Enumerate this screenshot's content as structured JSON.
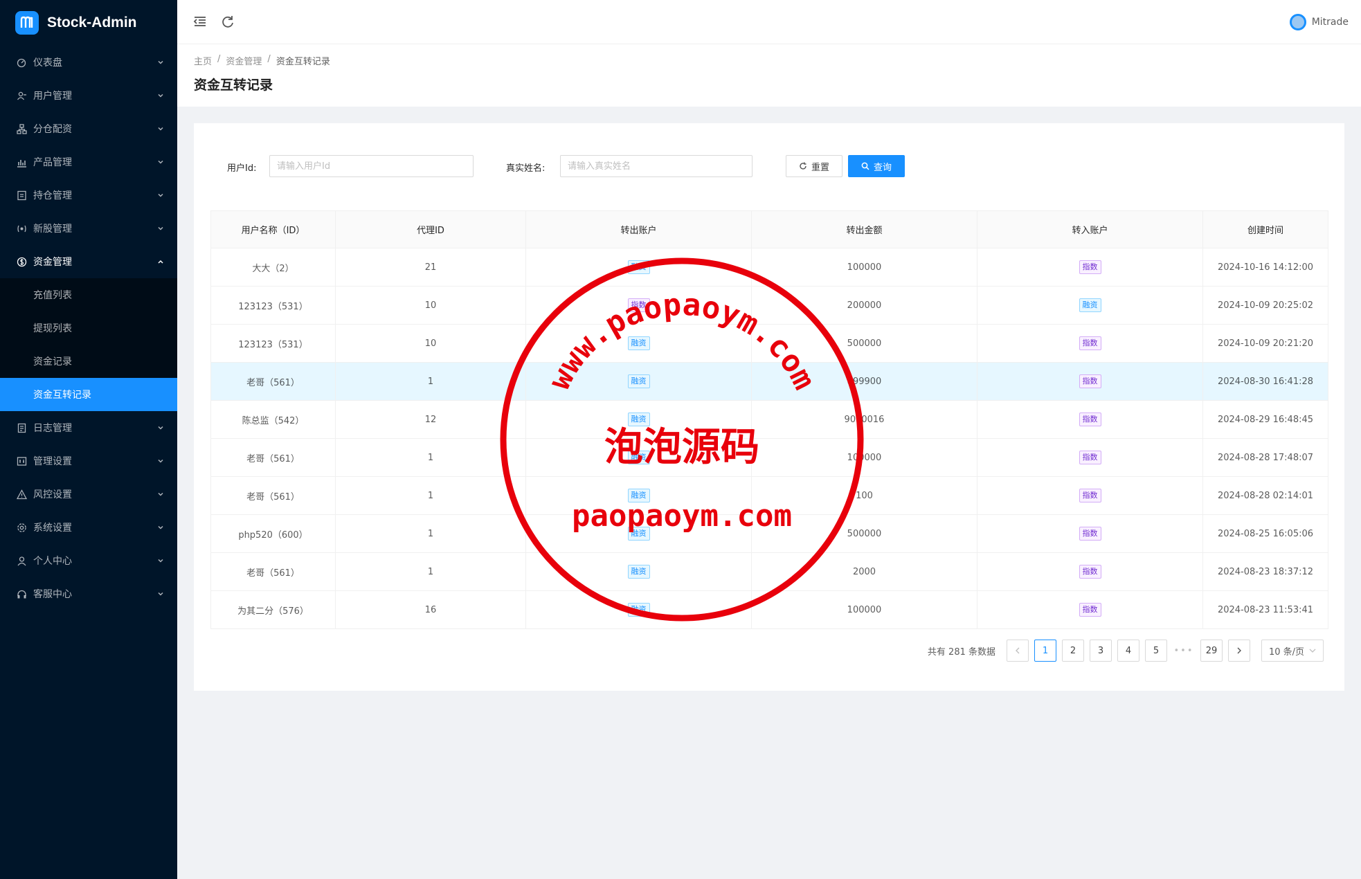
{
  "app": {
    "title": "Stock-Admin"
  },
  "header": {
    "username": "Mitrade"
  },
  "sidebar": {
    "items": [
      {
        "label": "仪表盘",
        "icon": "dashboard-icon"
      },
      {
        "label": "用户管理",
        "icon": "users-icon"
      },
      {
        "label": "分仓配资",
        "icon": "cluster-icon"
      },
      {
        "label": "产品管理",
        "icon": "bar-chart-icon"
      },
      {
        "label": "持仓管理",
        "icon": "holding-icon"
      },
      {
        "label": "新股管理",
        "icon": "new-stock-icon"
      },
      {
        "label": "资金管理",
        "icon": "dollar-circle-icon",
        "open": true
      },
      {
        "label": "日志管理",
        "icon": "log-icon"
      },
      {
        "label": "管理设置",
        "icon": "admin-settings-icon"
      },
      {
        "label": "风控设置",
        "icon": "warning-icon"
      },
      {
        "label": "系统设置",
        "icon": "gear-icon"
      },
      {
        "label": "个人中心",
        "icon": "user-icon"
      },
      {
        "label": "客服中心",
        "icon": "headset-icon"
      }
    ],
    "fund_submenu": [
      {
        "label": "充值列表"
      },
      {
        "label": "提现列表"
      },
      {
        "label": "资金记录"
      },
      {
        "label": "资金互转记录",
        "active": true
      }
    ]
  },
  "breadcrumb": {
    "home": "主页",
    "parent": "资金管理",
    "current": "资金互转记录"
  },
  "page_title": "资金互转记录",
  "filters": {
    "user_id_label": "用户Id:",
    "user_id_placeholder": "请输入用户Id",
    "real_name_label": "真实姓名:",
    "real_name_placeholder": "请输入真实姓名",
    "reset_label": "重置",
    "query_label": "查询"
  },
  "table": {
    "columns": [
      "用户名称（ID）",
      "代理ID",
      "转出账户",
      "转出金额",
      "转入账户",
      "创建时间"
    ],
    "rows": [
      {
        "user": "大大（2）",
        "agent": "21",
        "from": "融资",
        "amount": "100000",
        "to": "指数",
        "time": "2024-10-16 14:12:00"
      },
      {
        "user": "123123（531）",
        "agent": "10",
        "from": "指数",
        "amount": "200000",
        "to": "融资",
        "time": "2024-10-09 20:25:02"
      },
      {
        "user": "123123（531）",
        "agent": "10",
        "from": "融资",
        "amount": "500000",
        "to": "指数",
        "time": "2024-10-09 20:21:20"
      },
      {
        "user": "老哥（561）",
        "agent": "1",
        "from": "融资",
        "amount": "899900",
        "to": "指数",
        "time": "2024-08-30 16:41:28"
      },
      {
        "user": "陈总监（542）",
        "agent": "12",
        "from": "融资",
        "amount": "9000016",
        "to": "指数",
        "time": "2024-08-29 16:48:45"
      },
      {
        "user": "老哥（561）",
        "agent": "1",
        "from": "融资",
        "amount": "100000",
        "to": "指数",
        "time": "2024-08-28 17:48:07"
      },
      {
        "user": "老哥（561）",
        "agent": "1",
        "from": "融资",
        "amount": "100",
        "to": "指数",
        "time": "2024-08-28 02:14:01"
      },
      {
        "user": "php520（600）",
        "agent": "1",
        "from": "融资",
        "amount": "500000",
        "to": "指数",
        "time": "2024-08-25 16:05:06"
      },
      {
        "user": "老哥（561）",
        "agent": "1",
        "from": "融资",
        "amount": "2000",
        "to": "指数",
        "time": "2024-08-23 18:37:12"
      },
      {
        "user": "为其二分（576）",
        "agent": "16",
        "from": "融资",
        "amount": "100000",
        "to": "指数",
        "time": "2024-08-23 11:53:41"
      }
    ],
    "highlight_row": 3
  },
  "pagination": {
    "total_text": "共有 281 条数据",
    "pages": [
      "1",
      "2",
      "3",
      "4",
      "5"
    ],
    "last_page": "29",
    "current": "1",
    "page_size": "10 条/页"
  },
  "watermark": {
    "url_arc": "www.paopaoym.com",
    "brand_cn": "泡泡源码",
    "brand_en": "paopaoym.com"
  },
  "colors": {
    "sidebar_bg": "#001529",
    "accent": "#1890ff",
    "stamp": "#e8000b"
  }
}
